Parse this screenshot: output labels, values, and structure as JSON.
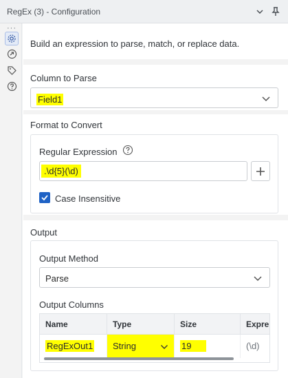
{
  "window": {
    "title": "RegEx (3) - Configuration"
  },
  "description": "Build an expression to parse, match, or replace data.",
  "column_to_parse": {
    "label": "Column to Parse",
    "value": "Field1"
  },
  "format_to_convert": {
    "label": "Format to Convert",
    "regex_label": "Regular Expression",
    "regex_value": ".\\d{5}(\\d)",
    "case_insensitive_label": "Case Insensitive",
    "case_insensitive_checked": true
  },
  "output": {
    "label": "Output",
    "method_label": "Output Method",
    "method_value": "Parse",
    "columns_label": "Output Columns",
    "table": {
      "headers": [
        "Name",
        "Type",
        "Size",
        "Expre"
      ],
      "row": {
        "name": "RegExOut1",
        "type": "String",
        "size": "19",
        "expression": "(\\d)"
      }
    }
  },
  "colors": {
    "accent": "#1f62c5",
    "highlight": "#ffff00"
  }
}
